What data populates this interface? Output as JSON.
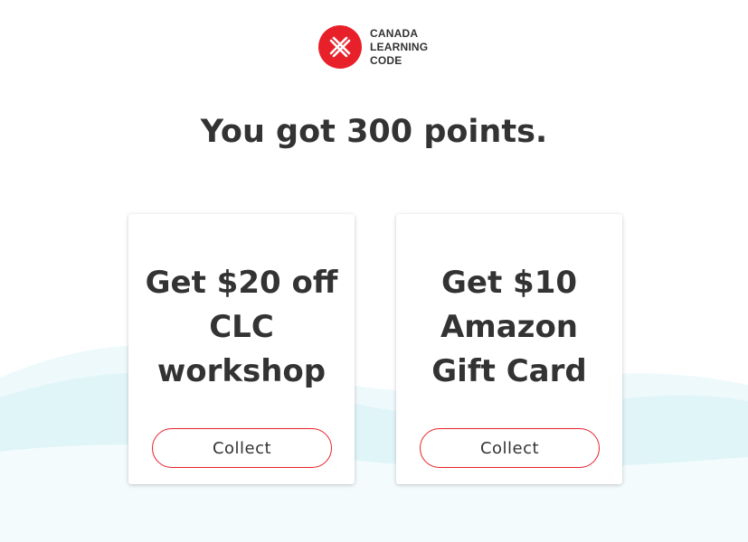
{
  "brand": {
    "line1": "CANADA",
    "line2": "LEARNING",
    "line3": "CODE",
    "accent_color": "#e8202a",
    "logo_icon": "clc-logo-icon"
  },
  "headline": "You got 300 points.",
  "rewards": [
    {
      "title_lines": [
        "Get $20 off",
        "CLC",
        "workshop"
      ],
      "button_label": "Collect"
    },
    {
      "title_lines": [
        "Get $10",
        "Amazon",
        "Gift Card"
      ],
      "button_label": "Collect"
    }
  ],
  "colors": {
    "text": "#333333",
    "wave_light": "#eef9fb",
    "wave_mid": "#dcf4f7"
  }
}
